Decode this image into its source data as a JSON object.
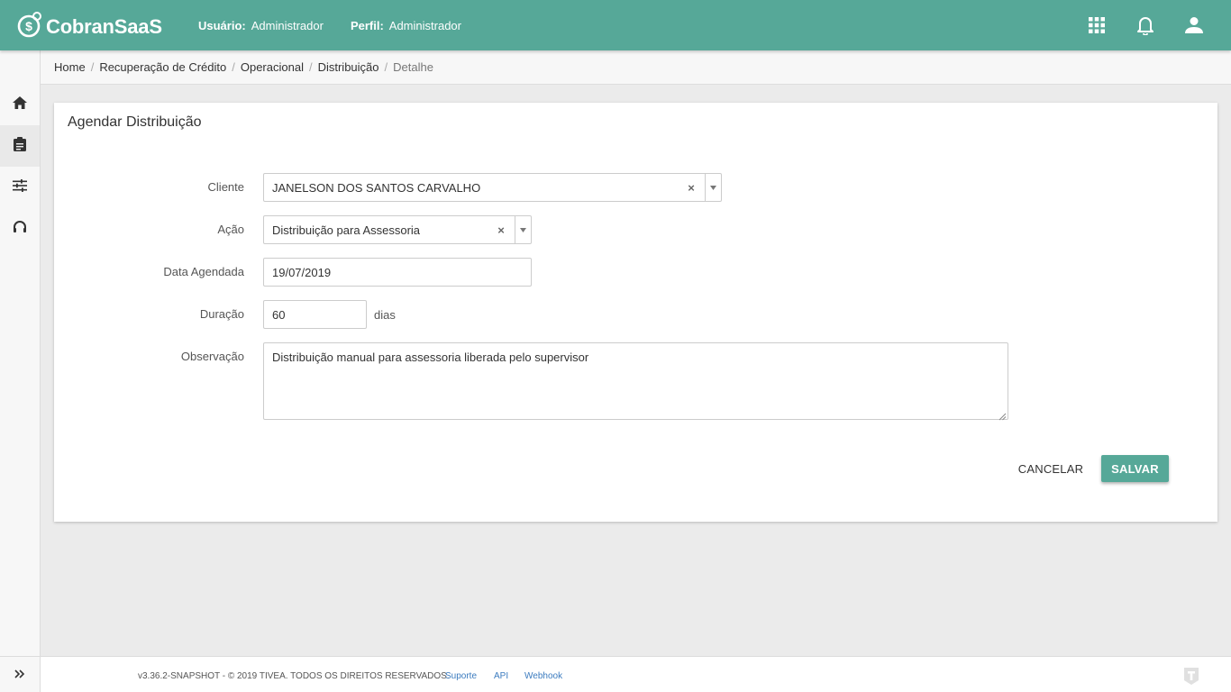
{
  "header": {
    "brand": "CobranSaaS",
    "user_key": "Usuário:",
    "user_value": "Administrador",
    "profile_key": "Perfil:",
    "profile_value": "Administrador",
    "icons": [
      "apps-grid-icon",
      "bell-icon",
      "user-icon"
    ]
  },
  "sidebar": {
    "items": [
      {
        "icon": "home-icon",
        "active": false
      },
      {
        "icon": "clipboard-icon",
        "active": true
      },
      {
        "icon": "sliders-icon",
        "active": false
      },
      {
        "icon": "headset-icon",
        "active": false
      }
    ],
    "expand_label": "»"
  },
  "breadcrumb": {
    "items": [
      "Home",
      "Recuperação de Crédito",
      "Operacional",
      "Distribuição"
    ],
    "current": "Detalhe",
    "separator": "/"
  },
  "form": {
    "title": "Agendar Distribuição",
    "cliente_label": "Cliente",
    "cliente_value": "JANELSON DOS SANTOS CARVALHO",
    "acao_label": "Ação",
    "acao_value": "Distribuição para Assessoria",
    "data_label": "Data Agendada",
    "data_value": "19/07/2019",
    "duracao_label": "Duração",
    "duracao_value": "60",
    "duracao_suffix": "dias",
    "obs_label": "Observação",
    "obs_value": "Distribuição manual para assessoria liberada pelo supervisor",
    "clear_symbol": "×",
    "cancel_label": "CANCELAR",
    "save_label": "SALVAR"
  },
  "footer": {
    "version": "v3.36.2-SNAPSHOT - © 2019 TIVEA. TODOS OS DIREITOS RESERVADOS.",
    "link_support": "Suporte",
    "link_api": "API",
    "link_webhook": "Webhook"
  },
  "colors": {
    "primary": "#56a898",
    "link": "#3b7bbf",
    "background": "#ebebeb"
  }
}
